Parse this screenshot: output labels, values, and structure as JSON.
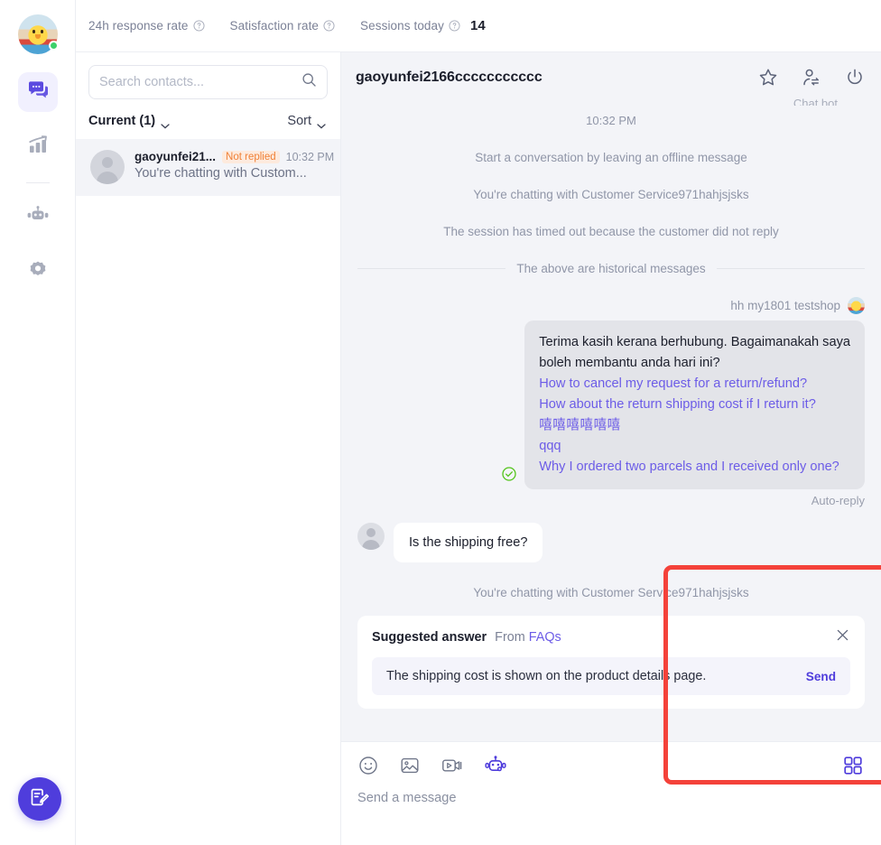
{
  "topbar": {
    "stats": [
      {
        "label": "24h response rate",
        "value": "",
        "icon": "question-circle-icon"
      },
      {
        "label": "Satisfaction rate",
        "value": "",
        "icon": "question-circle-icon"
      },
      {
        "label": "Sessions today",
        "value": "14",
        "icon": "question-circle-icon"
      }
    ]
  },
  "rail": {
    "items": [
      {
        "name": "brand-avatar",
        "icon": "user-avatar",
        "active": false
      },
      {
        "name": "conversations",
        "icon": "chat-bubble-icon",
        "active": true
      },
      {
        "name": "analytics",
        "icon": "bar-chart-icon",
        "active": false
      },
      {
        "name": "chatbot",
        "icon": "robot-icon",
        "active": false
      },
      {
        "name": "settings",
        "icon": "gear-icon",
        "active": false
      }
    ],
    "fab": {
      "icon": "compose-note-icon",
      "color": "#4f3ddc"
    }
  },
  "contacts": {
    "search": {
      "placeholder": "Search contacts...",
      "value": "",
      "icon": "search-icon"
    },
    "filter": {
      "label": "Current (1)",
      "icon": "chevron-down-icon"
    },
    "sort": {
      "label": "Sort",
      "icon": "chevron-down-icon"
    },
    "list": [
      {
        "name": "gaoyunfei21...",
        "badge": "Not replied",
        "time": "10:32 PM",
        "preview": "You're chatting with Custom...",
        "avatar": "person-placeholder-icon"
      }
    ]
  },
  "chat": {
    "title": "gaoyunfei2166ccccccccccc",
    "actions": [
      {
        "name": "star-button",
        "icon": "star-icon"
      },
      {
        "name": "transfer-button",
        "icon": "transfer-user-icon"
      },
      {
        "name": "end-session-button",
        "icon": "power-icon"
      }
    ],
    "tooltip": "Chat bot",
    "system": {
      "time": "10:32 PM",
      "offline_note": "Start a conversation by leaving an offline message",
      "chatting_with": "You're chatting with Customer Service971hahjsjsks",
      "timeout": "The session has timed out because the customer did not reply",
      "divider": "The above are historical messages"
    },
    "outgoing": {
      "sender": "hh my1801 testshop",
      "greeting_line1": "Terima kasih kerana berhubung. Bagaimanakah saya",
      "greeting_line2": "boleh membantu anda hari ini?",
      "quick_replies": [
        "How to cancel my request for a return/refund?",
        "How about the return shipping cost if I return it?",
        "嘻嘻嘻嘻嘻嘻",
        "qqq",
        "Why I ordered two parcels and I received only one?"
      ],
      "status": "Auto-reply",
      "check_icon": "check-circle-icon"
    },
    "incoming": {
      "text": "Is the shipping free?",
      "avatar": "person-placeholder-icon"
    },
    "chatting_with_2": "You're chatting with Customer Service971hahjsjsks",
    "suggestion": {
      "title": "Suggested answer",
      "from_label": "From",
      "from_source": "FAQs",
      "close_icon": "close-icon",
      "text": "The shipping cost is shown on the product details page.",
      "send_label": "Send"
    },
    "highlight": {
      "color": "#f4423a"
    }
  },
  "composer": {
    "tools": [
      {
        "name": "emoji-button",
        "icon": "smiley-icon"
      },
      {
        "name": "image-button",
        "icon": "image-icon"
      },
      {
        "name": "video-button",
        "icon": "video-camera-icon"
      },
      {
        "name": "chatbot-button",
        "icon": "robot-icon"
      }
    ],
    "grid": {
      "name": "apps-grid-button",
      "icon": "grid-icon"
    },
    "placeholder": "Send a message"
  }
}
